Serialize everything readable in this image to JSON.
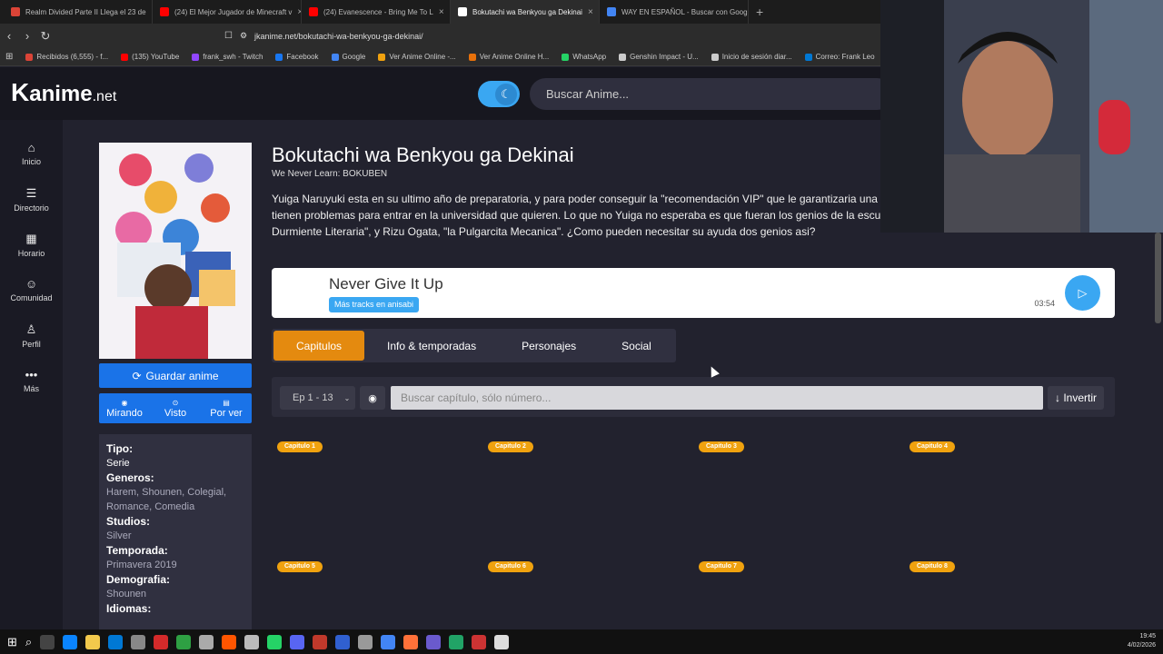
{
  "browser": {
    "tabs": [
      {
        "title": "Realm Divided Parte II Llega el 23 de",
        "color": "#db4437"
      },
      {
        "title": "(24) El Mejor Jugador de Minecraft v",
        "color": "#ff0000"
      },
      {
        "title": "(24) Evanescence - Bring Me To L",
        "color": "#ff0000"
      },
      {
        "title": "Bokutachi wa Benkyou ga Dekinai",
        "color": "#ffffff"
      },
      {
        "title": "WAY EN ESPAÑOL - Buscar con Goog",
        "color": "#4285f4"
      }
    ],
    "url": "jkanime.net/bokutachi-wa-benkyou-ga-dekinai/",
    "bookmarks": [
      {
        "label": "Recibidos (6,555) - f...",
        "color": "#db4437"
      },
      {
        "label": "(135) YouTube",
        "color": "#ff0000"
      },
      {
        "label": "frank_swh - Twitch",
        "color": "#9146ff"
      },
      {
        "label": "Facebook",
        "color": "#1877f2"
      },
      {
        "label": "Google",
        "color": "#4285f4"
      },
      {
        "label": "Ver Anime Online -...",
        "color": "#f0a20f"
      },
      {
        "label": "Ver Anime Online H...",
        "color": "#e8710a"
      },
      {
        "label": "WhatsApp",
        "color": "#25d366"
      },
      {
        "label": "Genshin Impact - U...",
        "color": "#cccccc"
      },
      {
        "label": "Inicio de sesión diar...",
        "color": "#cccccc"
      },
      {
        "label": "Correo: Frank Leo",
        "color": "#0078d4"
      }
    ]
  },
  "header": {
    "logo_k": "K",
    "logo_main": "anime",
    "logo_net": ".net",
    "search_placeholder": "Buscar Anime..."
  },
  "sidebar": [
    {
      "label": "Inicio",
      "icon": "home-icon",
      "glyph": "⌂"
    },
    {
      "label": "Directorio",
      "icon": "list-icon",
      "glyph": "☰"
    },
    {
      "label": "Horario",
      "icon": "calendar-icon",
      "glyph": "▦"
    },
    {
      "label": "Comunidad",
      "icon": "users-icon",
      "glyph": "☺"
    },
    {
      "label": "Perfil",
      "icon": "user-icon",
      "glyph": "♙"
    },
    {
      "label": "Más",
      "icon": "more-icon",
      "glyph": "•••"
    }
  ],
  "anime": {
    "title": "Bokutachi wa Benkyou ga Dekinai",
    "alt_title": "We Never Learn: BOKUBEN",
    "description": "Yuiga Naruyuki esta en su ultimo año de preparatoria, y para poder conseguir la \"recomendación VIP\" que le garantizaria una beca, debera ser tutor de unas compañeras que tienen problemas para entrar en la universidad que quieren. Lo que no Yuiga no esperaba es que fueran los genios de la escuela: la hermosa Fumino Furuharashi, \"la Bella Durmiente Literaria\", y Rizu Ogata, \"la Pulgarcita Mecanica\". ¿Como pueden necesitar su ayuda dos genios asi?",
    "save_label": "Guardar anime",
    "status_buttons": [
      "Mirando",
      "Visto",
      "Por ver"
    ]
  },
  "info": [
    {
      "key": "Tipo:",
      "value": "Serie",
      "white": true
    },
    {
      "key": "Generos:",
      "value": "Harem, Shounen, Colegial, Romance, Comedia",
      "white": false
    },
    {
      "key": "Studios:",
      "value": "Silver",
      "white": false
    },
    {
      "key": "Temporada:",
      "value": "Primavera 2019",
      "white": false
    },
    {
      "key": "Demografia:",
      "value": "Shounen",
      "white": false
    },
    {
      "key": "Idiomas:",
      "value": "",
      "white": false
    }
  ],
  "player": {
    "track": "Never Give It Up",
    "more_label": "Más tracks en anisabi",
    "time": "03:54"
  },
  "tabs": [
    "Capitulos",
    "Info & temporadas",
    "Personajes",
    "Social"
  ],
  "active_tab": 0,
  "episodes_filter": {
    "range": "Ep 1 - 13",
    "search_placeholder": "Buscar capítulo, sólo número...",
    "invert_label": "↓ Invertir"
  },
  "episodes": [
    "Capitulo 1",
    "Capitulo 2",
    "Capitulo 3",
    "Capitulo 4",
    "Capitulo 5",
    "Capitulo 6",
    "Capitulo 7",
    "Capitulo 8"
  ],
  "taskbar": {
    "time": "19:45",
    "date": "4/02/2026"
  }
}
